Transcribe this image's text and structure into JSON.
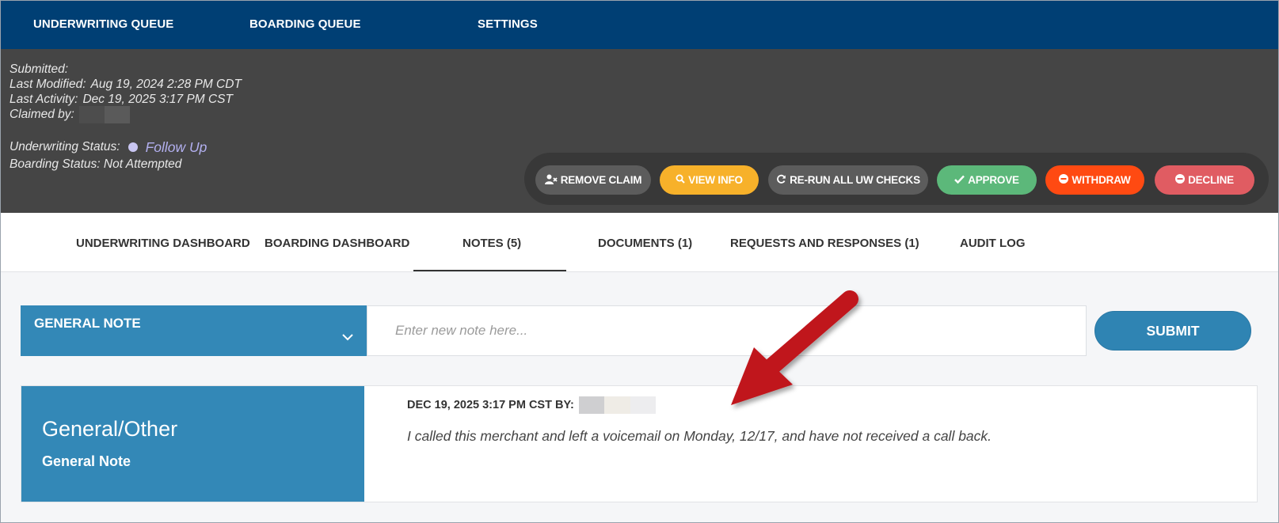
{
  "nav": {
    "items": [
      "UNDERWRITING QUEUE",
      "BOARDING QUEUE",
      "SETTINGS"
    ]
  },
  "header": {
    "submitted_label": "Submitted:",
    "submitted_value": "",
    "last_modified_label": "Last Modified:",
    "last_modified_value": "Aug 19, 2024 2:28 PM CDT",
    "last_activity_label": "Last Activity:",
    "last_activity_value": "Dec 19, 2025 3:17 PM CST",
    "claimed_by_label": "Claimed by:",
    "uw_status_label": "Underwriting Status:",
    "uw_status_value": "Follow Up",
    "boarding_status": "Boarding Status: Not Attempted"
  },
  "actions": {
    "remove_claim": "REMOVE CLAIM",
    "view_info": "VIEW INFO",
    "rerun": "RE-RUN ALL UW CHECKS",
    "approve": "APPROVE",
    "withdraw": "WITHDRAW",
    "decline": "DECLINE"
  },
  "tabs": [
    "UNDERWRITING DASHBOARD",
    "BOARDING DASHBOARD",
    "NOTES (5)",
    "DOCUMENTS (1)",
    "REQUESTS AND RESPONSES (1)",
    "AUDIT LOG"
  ],
  "note_entry": {
    "type_selected": "GENERAL NOTE",
    "placeholder": "Enter new note here...",
    "submit": "SUBMIT"
  },
  "notes": [
    {
      "category": "General/Other",
      "type": "General Note",
      "header": "DEC 19, 2025 3:17 PM CST BY:",
      "text": "I called this merchant and left a voicemail on Monday, 12/17, and have not received a call back."
    }
  ],
  "colors": {
    "nav_bg": "#003f74",
    "header_bg": "#454545",
    "primary_blue": "#3388b7",
    "view_info": "#f7b12a",
    "approve": "#5cb87a",
    "withdraw": "#ff4a12",
    "decline": "#e05c62",
    "neutral_btn": "#5c5c5c",
    "annotation_arrow": "#c0121a"
  },
  "icons": {
    "remove_claim": "user-times-icon",
    "view_info": "search-icon",
    "rerun": "refresh-icon",
    "approve": "check-icon",
    "withdraw": "minus-circle-icon",
    "decline": "minus-circle-icon"
  }
}
